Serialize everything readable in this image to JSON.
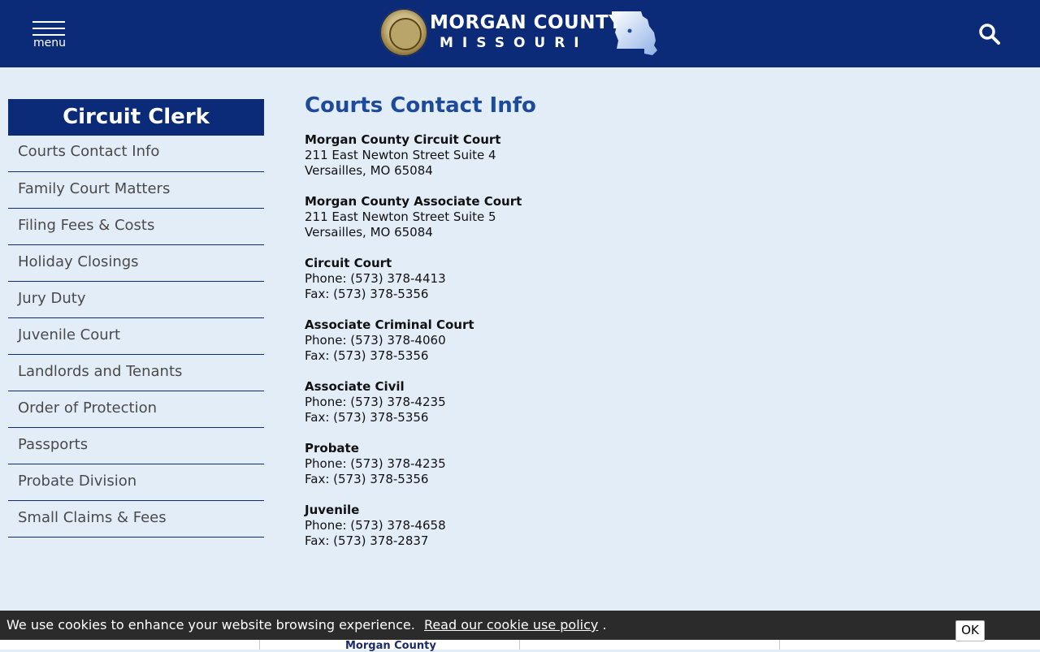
{
  "header": {
    "menu_label": "menu",
    "logo_title": "MORGAN COUNTY",
    "logo_subtitle": "MISSOURI",
    "colors": {
      "bar": "#0b2b78",
      "accent": "#1d4a9b"
    }
  },
  "sidebar": {
    "title": "Circuit Clerk",
    "items": [
      {
        "label": "Courts Contact Info"
      },
      {
        "label": "Family Court Matters"
      },
      {
        "label": "Filing Fees & Costs"
      },
      {
        "label": "Holiday Closings"
      },
      {
        "label": "Jury Duty"
      },
      {
        "label": "Juvenile Court"
      },
      {
        "label": "Landlords and Tenants"
      },
      {
        "label": "Order of Protection"
      },
      {
        "label": "Passports"
      },
      {
        "label": "Probate Division"
      },
      {
        "label": "Small Claims & Fees"
      }
    ]
  },
  "main": {
    "title": "Courts Contact Info",
    "blocks": [
      {
        "name": "Morgan County Circuit Court",
        "lines": [
          "211 East Newton Street Suite 4",
          "Versailles, MO 65084"
        ]
      },
      {
        "name": "Morgan County Associate Court",
        "lines": [
          "211 East Newton Street Suite 5",
          "Versailles, MO 65084"
        ]
      },
      {
        "name": "Circuit Court",
        "lines": [
          "Phone: (573) 378-4413",
          "Fax: (573) 378-5356"
        ]
      },
      {
        "name": "Associate Criminal Court",
        "lines": [
          "Phone: (573) 378-4060",
          "Fax: (573) 378-5356"
        ]
      },
      {
        "name": "Associate Civil",
        "lines": [
          "Phone: (573) 378-4235",
          "Fax: (573) 378-5356"
        ]
      },
      {
        "name": "Probate",
        "lines": [
          "Phone: (573) 378-4235",
          "Fax: (573) 378-5356"
        ]
      },
      {
        "name": "Juvenile",
        "lines": [
          "Phone: (573) 378-4658",
          "Fax: (573) 378-2837"
        ]
      }
    ]
  },
  "cookie": {
    "text": "We use cookies to enhance your website browsing experience.",
    "link": "Read our cookie use policy",
    "suffix": ".",
    "ok": "OK"
  },
  "footer": {
    "peek_text": "Morgan County"
  }
}
